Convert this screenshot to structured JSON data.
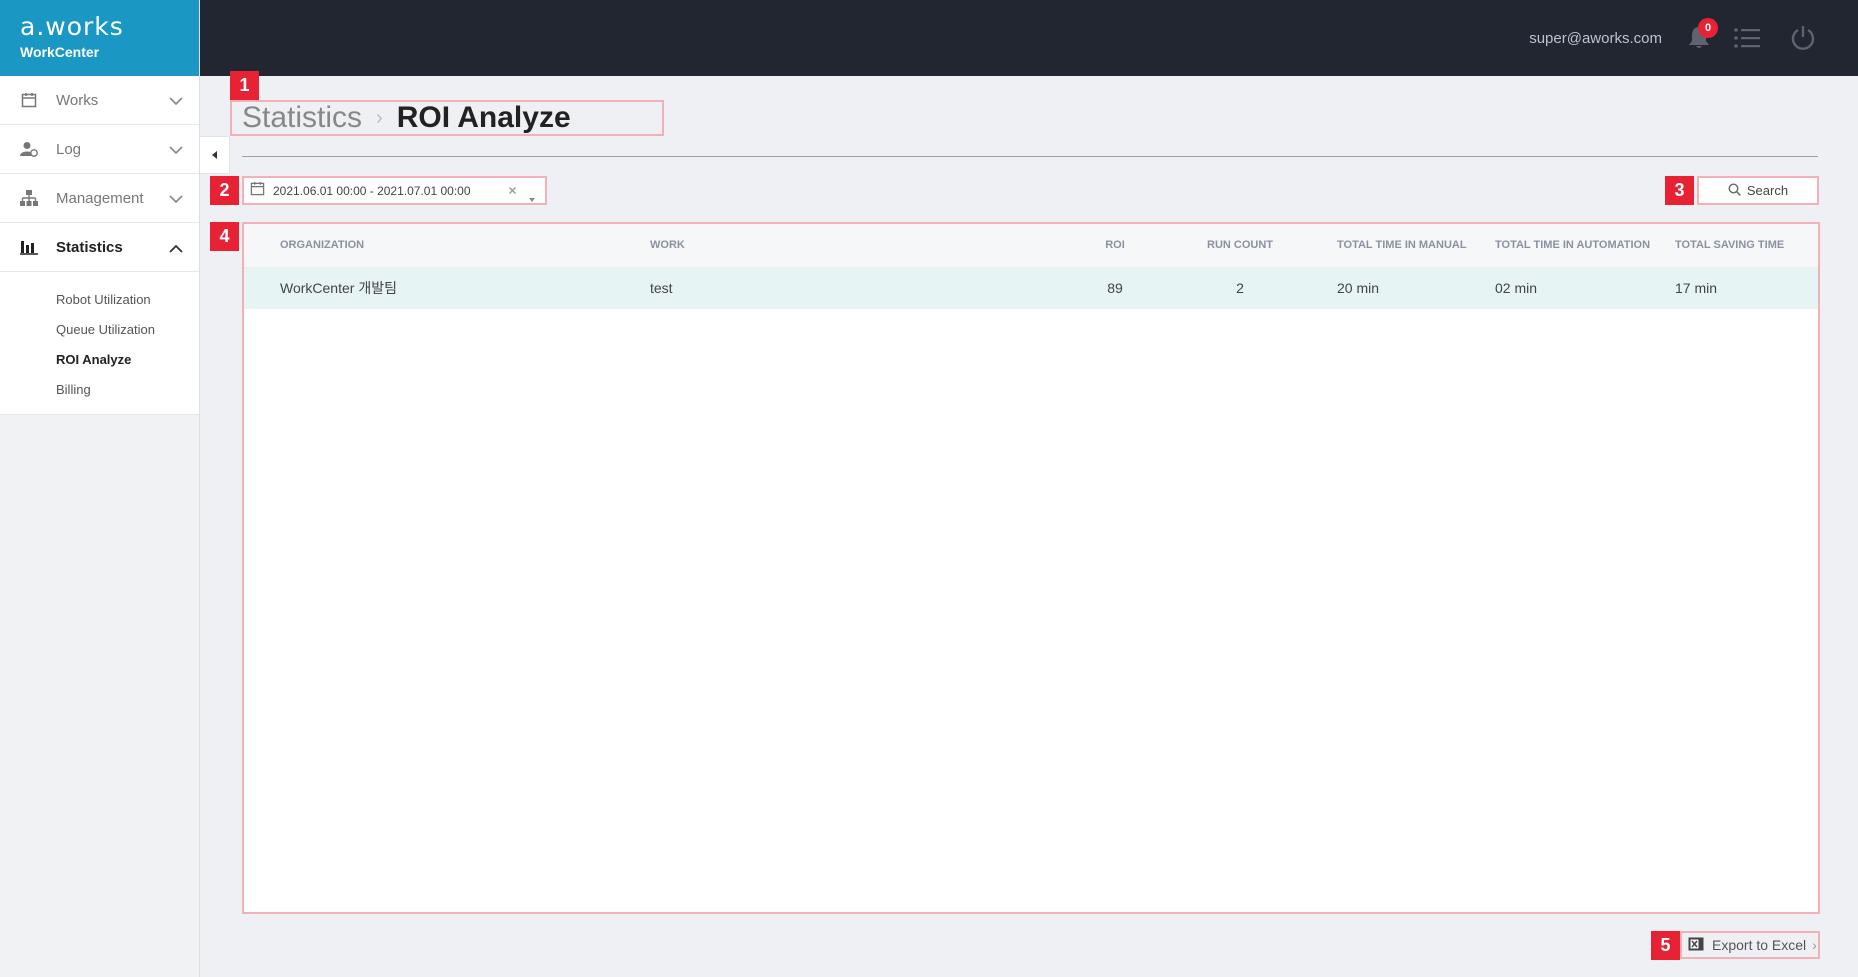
{
  "brand": {
    "logo": "a.works",
    "product": "WorkCenter"
  },
  "sidebar": {
    "items": [
      {
        "label": "Works",
        "icon": "calendar-icon"
      },
      {
        "label": "Log",
        "icon": "user-log-icon"
      },
      {
        "label": "Management",
        "icon": "org-chart-icon"
      },
      {
        "label": "Statistics",
        "icon": "bar-chart-icon",
        "active": true
      }
    ],
    "sub_items": [
      {
        "label": "Robot Utilization"
      },
      {
        "label": "Queue Utilization"
      },
      {
        "label": "ROI Analyze",
        "active": true
      },
      {
        "label": "Billing"
      }
    ]
  },
  "topbar": {
    "user_email": "super@aworks.com",
    "notification_count": "0"
  },
  "page": {
    "breadcrumb_parent": "Statistics",
    "breadcrumb_separator": "›",
    "title": "ROI Analyze"
  },
  "filters": {
    "date_range": "2021.06.01 00:00 - 2021.07.01 00:00",
    "search_label": "Search"
  },
  "table": {
    "headers": {
      "organization": "ORGANIZATION",
      "work": "WORK",
      "roi": "ROI",
      "run_count": "RUN COUNT",
      "manual": "TOTAL TIME IN MANUAL",
      "automation": "TOTAL TIME IN AUTOMATION",
      "saving": "TOTAL SAVING TIME"
    },
    "rows": [
      {
        "organization": "WorkCenter 개발팀",
        "work": "test",
        "roi": "89",
        "run_count": "2",
        "manual": "20 min",
        "automation": "02 min",
        "saving": "17 min"
      }
    ]
  },
  "footer": {
    "export_label": "Export to Excel",
    "export_arrow": "›"
  },
  "markers": [
    "1",
    "2",
    "3",
    "4",
    "5"
  ],
  "colors": {
    "brand": "#1a97c2",
    "topbar": "#222630",
    "marker": "#e82235",
    "highlight_border": "#f2b1b6",
    "selected_row": "#e7f4f4"
  }
}
